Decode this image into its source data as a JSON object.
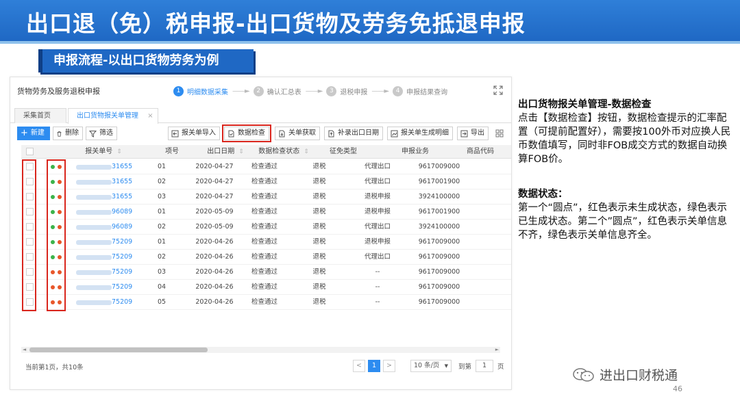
{
  "slide": {
    "title": "出口退（免）税申报-出口货物及劳务免抵退申报",
    "subtitle": "申报流程-以出口货物劳务为例",
    "page_number": "46",
    "watermark": "进出口财税通"
  },
  "app": {
    "title": "货物劳务及服务退税申报",
    "steps": [
      {
        "num": "1",
        "label": "明细数据采集"
      },
      {
        "num": "2",
        "label": "确认汇总表"
      },
      {
        "num": "3",
        "label": "退税申报"
      },
      {
        "num": "4",
        "label": "申报结果查询"
      }
    ],
    "tabs": [
      {
        "label": "采集首页"
      },
      {
        "label": "出口货物报关单管理",
        "close": "×"
      }
    ],
    "toolbar_left": {
      "add": "新建",
      "delete": "删除",
      "filter": "筛选"
    },
    "toolbar_right": {
      "import": "报关单导入",
      "check": "数据检查",
      "fetch": "关单获取",
      "date": "补录出口日期",
      "generate": "报关单生成明细",
      "export": "导出"
    },
    "columns": [
      "报关单号",
      "项号",
      "出口日期",
      "数据检查状态",
      "征免类型",
      "申报业务",
      "商品代码"
    ],
    "rows": [
      {
        "no": "31655",
        "item": "01",
        "date": "2020-04-27",
        "status": "检查通过",
        "type": "退税",
        "biz": "代理出口",
        "code": "9617009000",
        "dot1": "#3cb34a",
        "dot2": "#e8562a"
      },
      {
        "no": "31655",
        "item": "02",
        "date": "2020-04-27",
        "status": "检查通过",
        "type": "退税",
        "biz": "代理出口",
        "code": "9617001900",
        "dot1": "#3cb34a",
        "dot2": "#e8562a"
      },
      {
        "no": "31655",
        "item": "03",
        "date": "2020-04-27",
        "status": "检查通过",
        "type": "退税",
        "biz": "退税申报",
        "code": "3924100000",
        "dot1": "#3cb34a",
        "dot2": "#e8562a"
      },
      {
        "no": "96089",
        "item": "01",
        "date": "2020-05-09",
        "status": "检查通过",
        "type": "退税",
        "biz": "退税申报",
        "code": "9617001900",
        "dot1": "#3cb34a",
        "dot2": "#e8562a"
      },
      {
        "no": "96089",
        "item": "02",
        "date": "2020-05-09",
        "status": "检查通过",
        "type": "退税",
        "biz": "代理出口",
        "code": "3924100000",
        "dot1": "#3cb34a",
        "dot2": "#e8562a"
      },
      {
        "no": "75209",
        "item": "01",
        "date": "2020-04-26",
        "status": "检查通过",
        "type": "退税",
        "biz": "退税申报",
        "code": "9617009000",
        "dot1": "#3cb34a",
        "dot2": "#e8562a"
      },
      {
        "no": "75209",
        "item": "02",
        "date": "2020-04-26",
        "status": "检查通过",
        "type": "退税",
        "biz": "代理出口",
        "code": "9617009000",
        "dot1": "#3cb34a",
        "dot2": "#e8562a"
      },
      {
        "no": "75209",
        "item": "03",
        "date": "2020-04-26",
        "status": "检查通过",
        "type": "退税",
        "biz": "--",
        "code": "9617009000",
        "dot1": "#e8562a",
        "dot2": "#e8562a"
      },
      {
        "no": "75209",
        "item": "04",
        "date": "2020-04-26",
        "status": "检查通过",
        "type": "退税",
        "biz": "--",
        "code": "9617009000",
        "dot1": "#e8562a",
        "dot2": "#e8562a"
      },
      {
        "no": "75209",
        "item": "05",
        "date": "2020-04-26",
        "status": "检查通过",
        "type": "退税",
        "biz": "--",
        "code": "9617009000",
        "dot1": "#e8562a",
        "dot2": "#e8562a"
      }
    ],
    "footer": {
      "info": "当前第1页，共10条",
      "prev": "<",
      "page": "1",
      "next": ">",
      "page_size": "10 条/页",
      "goto_prefix": "到第",
      "goto_value": "1",
      "goto_suffix": "页"
    }
  },
  "explanation": {
    "heading1": "出口货物报关单管理-数据检查",
    "body1": "点击【数据检查】按钮，数据检查提示的汇率配置（可提前配置好），需要按100外币对应换人民币数值填写，同时非FOB成交方式的数据自动换算FOB价。",
    "heading2": "数据状态：",
    "body2": "第一个“圆点”，红色表示未生成状态，绿色表示已生成状态。第二个”圆点”，红色表示关单信息不齐，绿色表示关单信息齐全。"
  },
  "colors": {
    "banner": "#1f68c4",
    "accent": "#2d8cf0",
    "highlight_red": "#d9251c",
    "dot_green": "#3cb34a",
    "dot_red": "#e8562a"
  }
}
